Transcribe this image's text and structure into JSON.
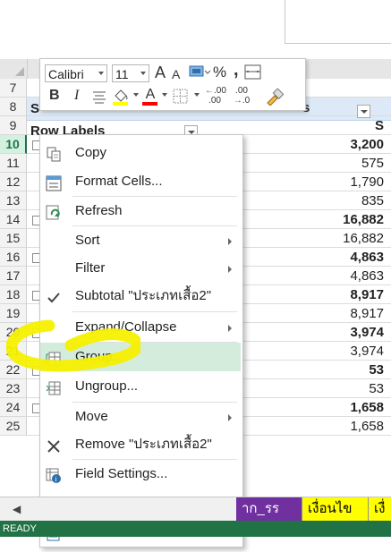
{
  "formula_box": "",
  "column_headers": {
    "top": "s"
  },
  "rows": [
    {
      "num": "7",
      "a": "",
      "val": ""
    },
    {
      "num": "8",
      "a": "S",
      "val": ""
    },
    {
      "num": "9",
      "a": "Row Labels",
      "val": "S"
    },
    {
      "num": "10",
      "a": "",
      "val": "3,200",
      "bold": true
    },
    {
      "num": "11",
      "a": "",
      "val": "575"
    },
    {
      "num": "12",
      "a": "",
      "val": "1,790"
    },
    {
      "num": "13",
      "a": "",
      "val": "835"
    },
    {
      "num": "14",
      "a": "",
      "val": "16,882",
      "bold": true
    },
    {
      "num": "15",
      "a": "",
      "val": "16,882"
    },
    {
      "num": "16",
      "a": "",
      "val": "4,863",
      "bold": true
    },
    {
      "num": "17",
      "a": "",
      "val": "4,863"
    },
    {
      "num": "18",
      "a": "",
      "val": "8,917",
      "bold": true
    },
    {
      "num": "19",
      "a": "",
      "val": "8,917"
    },
    {
      "num": "20",
      "a": "",
      "val": "3,974",
      "bold": true
    },
    {
      "num": "21",
      "a": "",
      "val": "3,974"
    },
    {
      "num": "22",
      "a": "",
      "val": "53",
      "bold": true
    },
    {
      "num": "23",
      "a": "",
      "val": "53"
    },
    {
      "num": "24",
      "a": "",
      "val": "1,658",
      "bold": true
    },
    {
      "num": "25",
      "a": "",
      "val": "1,658"
    }
  ],
  "mini_toolbar": {
    "font": "Calibri",
    "size": "11",
    "grow": "A",
    "shrink": "A",
    "percent": "%",
    "comma": ",",
    "bold": "B",
    "italic": "I",
    "font_color_letter": "A",
    "inc_decimal": ".00",
    "dec_decimal": ".0",
    "highlight_color": "#ffff00",
    "font_color": "#ff0000"
  },
  "menu": {
    "items": [
      {
        "label": "Copy",
        "icon": "copy-icon"
      },
      {
        "label": "Format Cells...",
        "icon": "format-cells-icon"
      },
      {
        "label": "Refresh",
        "icon": "refresh-icon"
      },
      {
        "label": "Sort",
        "submenu": true
      },
      {
        "label": "Filter",
        "submenu": true
      },
      {
        "label": "Subtotal \"ประเภทเสื้อ2\"",
        "icon": "check-icon"
      },
      {
        "label": "Expand/Collapse",
        "submenu": true
      },
      {
        "label": "Group...",
        "icon": "group-icon",
        "highlighted": true
      },
      {
        "label": "Ungroup...",
        "icon": "ungroup-icon"
      },
      {
        "label": "Move",
        "submenu": true
      },
      {
        "label": "Remove \"ประเภทเสื้อ2\"",
        "icon": "remove-icon"
      },
      {
        "label": "Field Settings...",
        "icon": "field-settings-icon"
      },
      {
        "label": "PivotTable Options..."
      },
      {
        "label": "Hide Field List",
        "icon": "field-list-icon"
      }
    ]
  },
  "sheet_tabs": [
    {
      "label": "าก_รร",
      "bg": "#7030a0",
      "color": "#ffffff"
    },
    {
      "label": "เงื่อนไข",
      "bg": "#ffff00",
      "color": "#000000"
    },
    {
      "label": "เงื่",
      "bg": "#ffff00",
      "color": "#000000"
    }
  ],
  "status": "READY",
  "colors": {
    "accent": "#217346",
    "header_band": "#dde9f7",
    "annotation": "#f5f000"
  }
}
